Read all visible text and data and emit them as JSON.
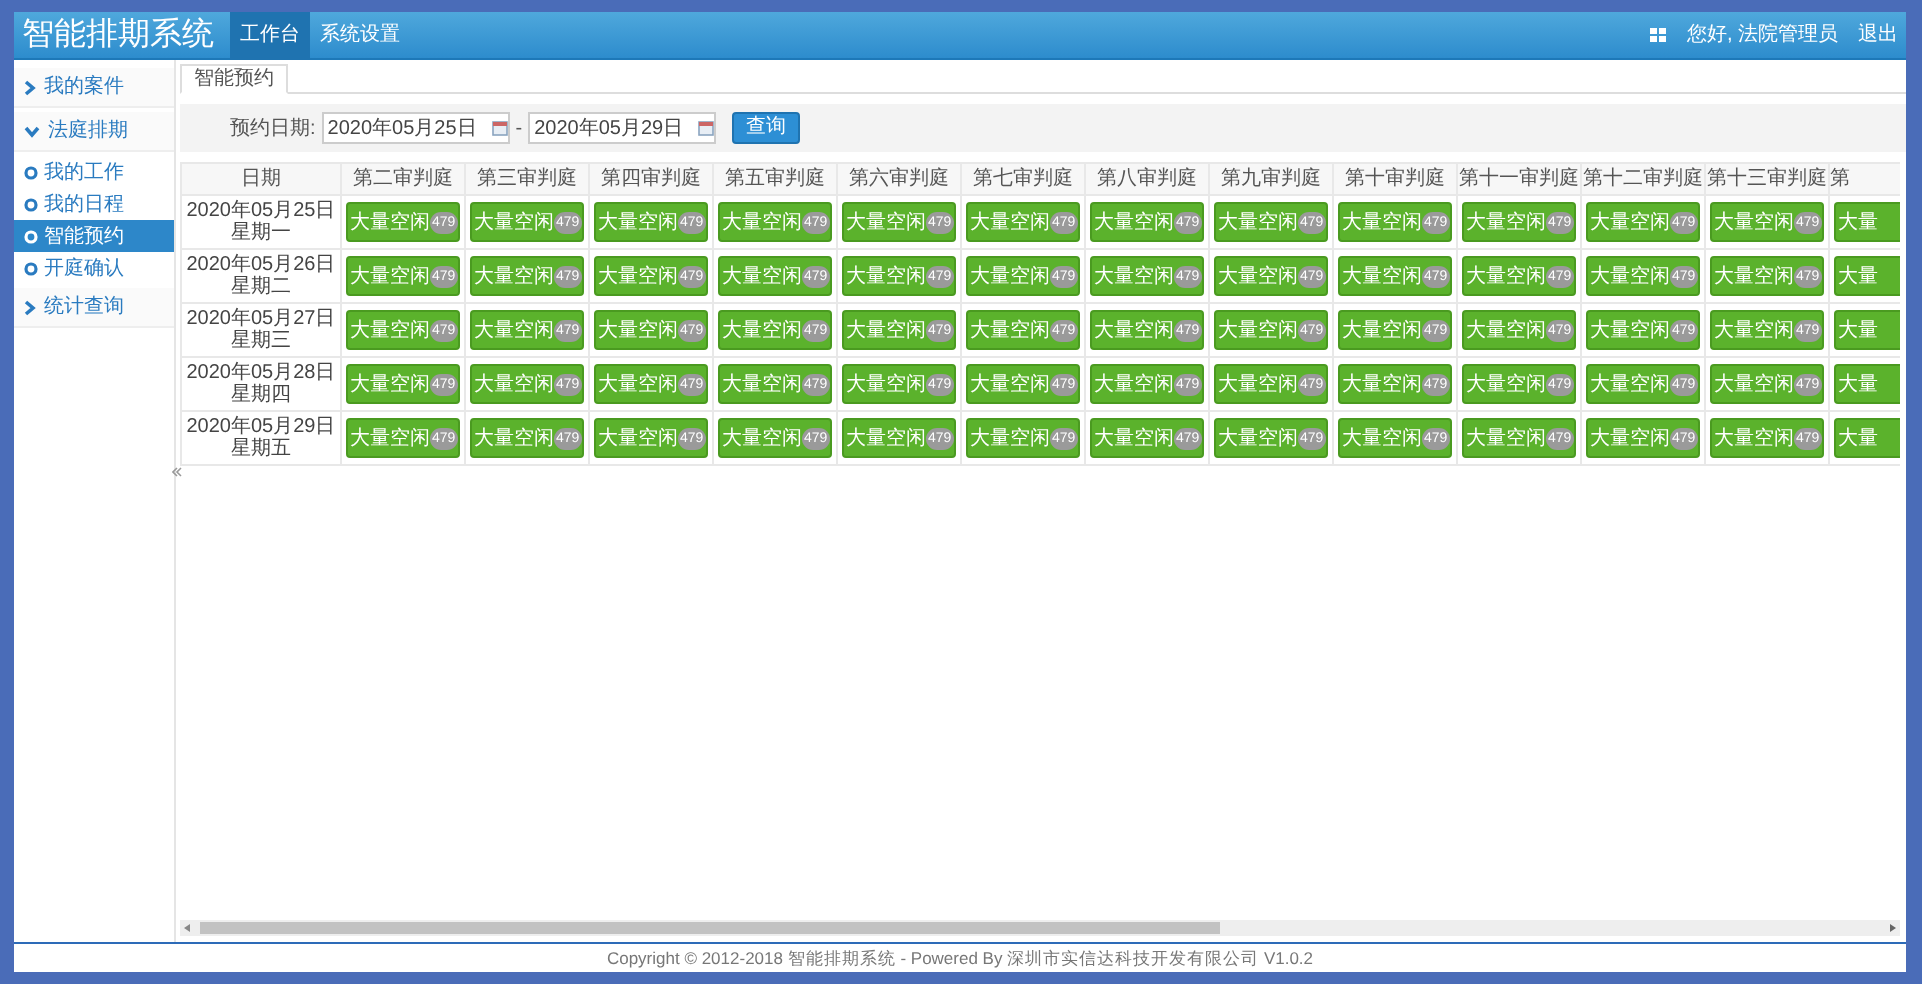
{
  "header": {
    "title": "智能排期系统",
    "nav": [
      {
        "label": "工作台",
        "selected": true
      },
      {
        "label": "系统设置",
        "selected": false
      }
    ],
    "greeting": "您好, 法院管理员",
    "logout": "退出"
  },
  "sidebar": {
    "items": [
      {
        "label": "我的案件",
        "expanded": false
      },
      {
        "label": "法庭排期",
        "expanded": true,
        "children": [
          {
            "label": "我的工作",
            "selected": false
          },
          {
            "label": "我的日程",
            "selected": false
          },
          {
            "label": "智能预约",
            "selected": true
          },
          {
            "label": "开庭确认",
            "selected": false
          }
        ]
      },
      {
        "label": "统计查询",
        "expanded": false
      }
    ]
  },
  "tabs": [
    {
      "label": "智能预约",
      "selected": true
    }
  ],
  "filter": {
    "label": "预约日期:",
    "start": "2020年05月25日",
    "separator": "-",
    "end": "2020年05月29日",
    "button": "查询"
  },
  "table": {
    "columns": [
      "日期",
      "第二审判庭",
      "第三审判庭",
      "第四审判庭",
      "第五审判庭",
      "第六审判庭",
      "第七审判庭",
      "第八审判庭",
      "第九审判庭",
      "第十审判庭",
      "第十一审判庭",
      "第十二审判庭",
      "第十三审判庭",
      "第"
    ],
    "rows": [
      {
        "date": "2020年05月25日",
        "weekday": "星期一",
        "slots": [
          {
            "text": "大量空闲",
            "count": "479"
          },
          {
            "text": "大量空闲",
            "count": "479"
          },
          {
            "text": "大量空闲",
            "count": "479"
          },
          {
            "text": "大量空闲",
            "count": "479"
          },
          {
            "text": "大量空闲",
            "count": "479"
          },
          {
            "text": "大量空闲",
            "count": "479"
          },
          {
            "text": "大量空闲",
            "count": "479"
          },
          {
            "text": "大量空闲",
            "count": "479"
          },
          {
            "text": "大量空闲",
            "count": "479"
          },
          {
            "text": "大量空闲",
            "count": "479"
          },
          {
            "text": "大量空闲",
            "count": "479"
          },
          {
            "text": "大量空闲",
            "count": "479"
          },
          {
            "text": "大量"
          }
        ]
      },
      {
        "date": "2020年05月26日",
        "weekday": "星期二",
        "slots": [
          {
            "text": "大量空闲",
            "count": "479"
          },
          {
            "text": "大量空闲",
            "count": "479"
          },
          {
            "text": "大量空闲",
            "count": "479"
          },
          {
            "text": "大量空闲",
            "count": "479"
          },
          {
            "text": "大量空闲",
            "count": "479"
          },
          {
            "text": "大量空闲",
            "count": "479"
          },
          {
            "text": "大量空闲",
            "count": "479"
          },
          {
            "text": "大量空闲",
            "count": "479"
          },
          {
            "text": "大量空闲",
            "count": "479"
          },
          {
            "text": "大量空闲",
            "count": "479"
          },
          {
            "text": "大量空闲",
            "count": "479"
          },
          {
            "text": "大量空闲",
            "count": "479"
          },
          {
            "text": "大量"
          }
        ]
      },
      {
        "date": "2020年05月27日",
        "weekday": "星期三",
        "slots": [
          {
            "text": "大量空闲",
            "count": "479"
          },
          {
            "text": "大量空闲",
            "count": "479"
          },
          {
            "text": "大量空闲",
            "count": "479"
          },
          {
            "text": "大量空闲",
            "count": "479"
          },
          {
            "text": "大量空闲",
            "count": "479"
          },
          {
            "text": "大量空闲",
            "count": "479"
          },
          {
            "text": "大量空闲",
            "count": "479"
          },
          {
            "text": "大量空闲",
            "count": "479"
          },
          {
            "text": "大量空闲",
            "count": "479"
          },
          {
            "text": "大量空闲",
            "count": "479"
          },
          {
            "text": "大量空闲",
            "count": "479"
          },
          {
            "text": "大量空闲",
            "count": "479"
          },
          {
            "text": "大量"
          }
        ]
      },
      {
        "date": "2020年05月28日",
        "weekday": "星期四",
        "slots": [
          {
            "text": "大量空闲",
            "count": "479"
          },
          {
            "text": "大量空闲",
            "count": "479"
          },
          {
            "text": "大量空闲",
            "count": "479"
          },
          {
            "text": "大量空闲",
            "count": "479"
          },
          {
            "text": "大量空闲",
            "count": "479"
          },
          {
            "text": "大量空闲",
            "count": "479"
          },
          {
            "text": "大量空闲",
            "count": "479"
          },
          {
            "text": "大量空闲",
            "count": "479"
          },
          {
            "text": "大量空闲",
            "count": "479"
          },
          {
            "text": "大量空闲",
            "count": "479"
          },
          {
            "text": "大量空闲",
            "count": "479"
          },
          {
            "text": "大量空闲",
            "count": "479"
          },
          {
            "text": "大量"
          }
        ]
      },
      {
        "date": "2020年05月29日",
        "weekday": "星期五",
        "slots": [
          {
            "text": "大量空闲",
            "count": "479"
          },
          {
            "text": "大量空闲",
            "count": "479"
          },
          {
            "text": "大量空闲",
            "count": "479"
          },
          {
            "text": "大量空闲",
            "count": "479"
          },
          {
            "text": "大量空闲",
            "count": "479"
          },
          {
            "text": "大量空闲",
            "count": "479"
          },
          {
            "text": "大量空闲",
            "count": "479"
          },
          {
            "text": "大量空闲",
            "count": "479"
          },
          {
            "text": "大量空闲",
            "count": "479"
          },
          {
            "text": "大量空闲",
            "count": "479"
          },
          {
            "text": "大量空闲",
            "count": "479"
          },
          {
            "text": "大量空闲",
            "count": "479"
          },
          {
            "text": "大量"
          }
        ]
      }
    ]
  },
  "footer": "Copyright © 2012-2018 智能排期系统 - Powered By 深圳市实信达科技开发有限公司 V1.0.2"
}
